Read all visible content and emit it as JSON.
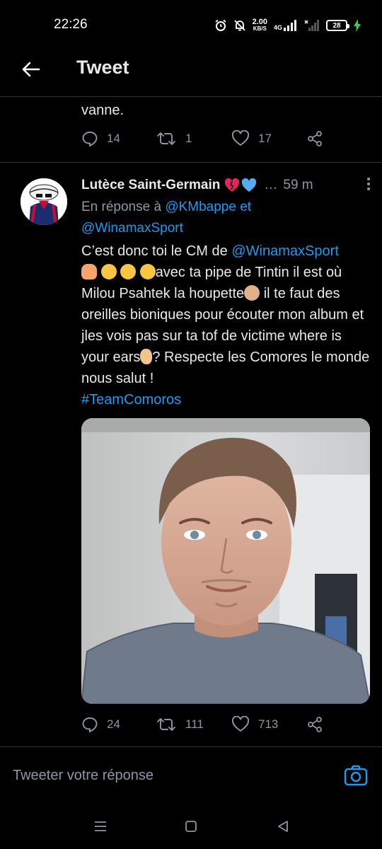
{
  "status_bar": {
    "time": "22:26",
    "net_speed_value": "2.00",
    "net_speed_unit": "KB/S",
    "network_type": "4G",
    "battery_level": "28"
  },
  "header": {
    "title": "Tweet"
  },
  "previous_tweet": {
    "text_tail": "vanne.",
    "replies": "14",
    "retweets": "1",
    "likes": "17"
  },
  "tweet": {
    "author_name": "Lutèce Saint-Germain",
    "author_emoji": [
      "broken-heart",
      "blue-heart"
    ],
    "time": "59 m",
    "reply_prefix": "En réponse à",
    "reply_to_1": "@KMbappe",
    "reply_conj": "et",
    "reply_to_2": "@WinamaxSport",
    "text_part1": "C’est donc toi le CM de ",
    "text_mention": "@WinamaxSport",
    "text_part2": "avec ta pipe de Tintin il est où Milou Psahtek la houpette",
    "text_part3": " il te faut des oreilles bioniques pour écouter mon album et jles vois pas sur ta tof de victime where is your ears",
    "text_part4": "? Respecte les Comores le monde nous salut !",
    "hashtag": "#TeamComoros",
    "replies": "24",
    "retweets": "111",
    "likes": "713"
  },
  "reply_bar": {
    "placeholder": "Tweeter votre réponse"
  },
  "colors": {
    "background": "#000000",
    "text": "#e7e9ea",
    "muted": "#8b98a5",
    "link": "#1d9bf0",
    "divider": "#2f3336"
  }
}
